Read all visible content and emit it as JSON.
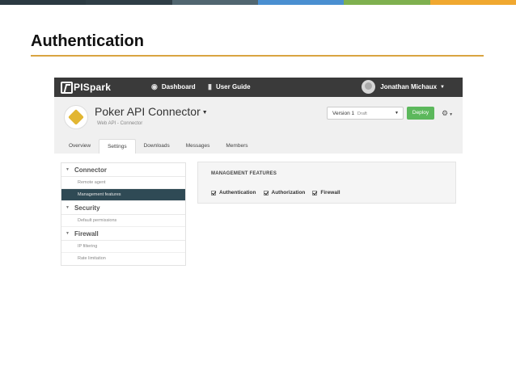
{
  "slide": {
    "title": "Authentication",
    "strip_colors": [
      "#2b3a42",
      "#2f3e46",
      "#516670",
      "#4a8fd1",
      "#7fb04f",
      "#f0a830"
    ]
  },
  "navbar": {
    "logo_text": "PISpark",
    "dashboard": "Dashboard",
    "user_guide": "User Guide",
    "user_name": "Jonathan Michaux"
  },
  "header": {
    "api_name": "Poker API Connector",
    "api_subtitle": "Web API - Connector",
    "version_label": "Version 1",
    "version_status": "Draft",
    "deploy_label": "Deploy",
    "tabs": [
      "Overview",
      "Settings",
      "Downloads",
      "Messages",
      "Members"
    ],
    "active_tab": "Settings"
  },
  "sidebar": {
    "sections": [
      {
        "title": "Connector",
        "items": [
          "Remote agent",
          "Management features"
        ]
      },
      {
        "title": "Security",
        "items": [
          "Default permissions"
        ]
      },
      {
        "title": "Firewall",
        "items": [
          "IP filtering",
          "Rate limitation"
        ]
      }
    ],
    "active_item": "Management features"
  },
  "panel": {
    "title": "MANAGEMENT FEATURES",
    "features": [
      {
        "label": "Authentication",
        "checked": true
      },
      {
        "label": "Authorization",
        "checked": true
      },
      {
        "label": "Firewall",
        "checked": true
      }
    ]
  },
  "colors": {
    "navbar": "#3a3a3a",
    "deploy": "#5cb85c",
    "active_sidebar": "#2f4a55",
    "title_rule": "#d9a441"
  }
}
